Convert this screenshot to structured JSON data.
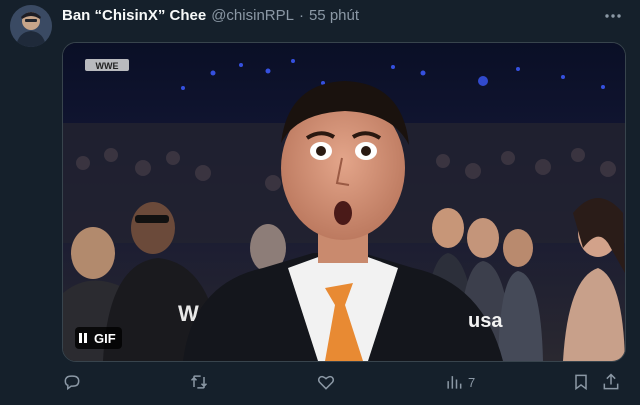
{
  "tweet": {
    "display_name": "Ban “ChisinX” Chee",
    "handle": "@chisinRPL",
    "separator": "·",
    "time": "55 phút"
  },
  "media": {
    "badge_label": "GIF",
    "watermark_top_left": "WWE",
    "logo_wwe": "W",
    "logo_network": "usa"
  },
  "actions": {
    "reply_icon": "reply-icon",
    "retweet_icon": "retweet-icon",
    "like_icon": "heart-icon",
    "views_icon": "views-icon",
    "views_count": "7",
    "bookmark_icon": "bookmark-icon",
    "share_icon": "share-icon"
  },
  "colors": {
    "background": "#15202b",
    "muted": "#8b98a5",
    "text": "#f7f9f9",
    "border": "#38444d"
  }
}
